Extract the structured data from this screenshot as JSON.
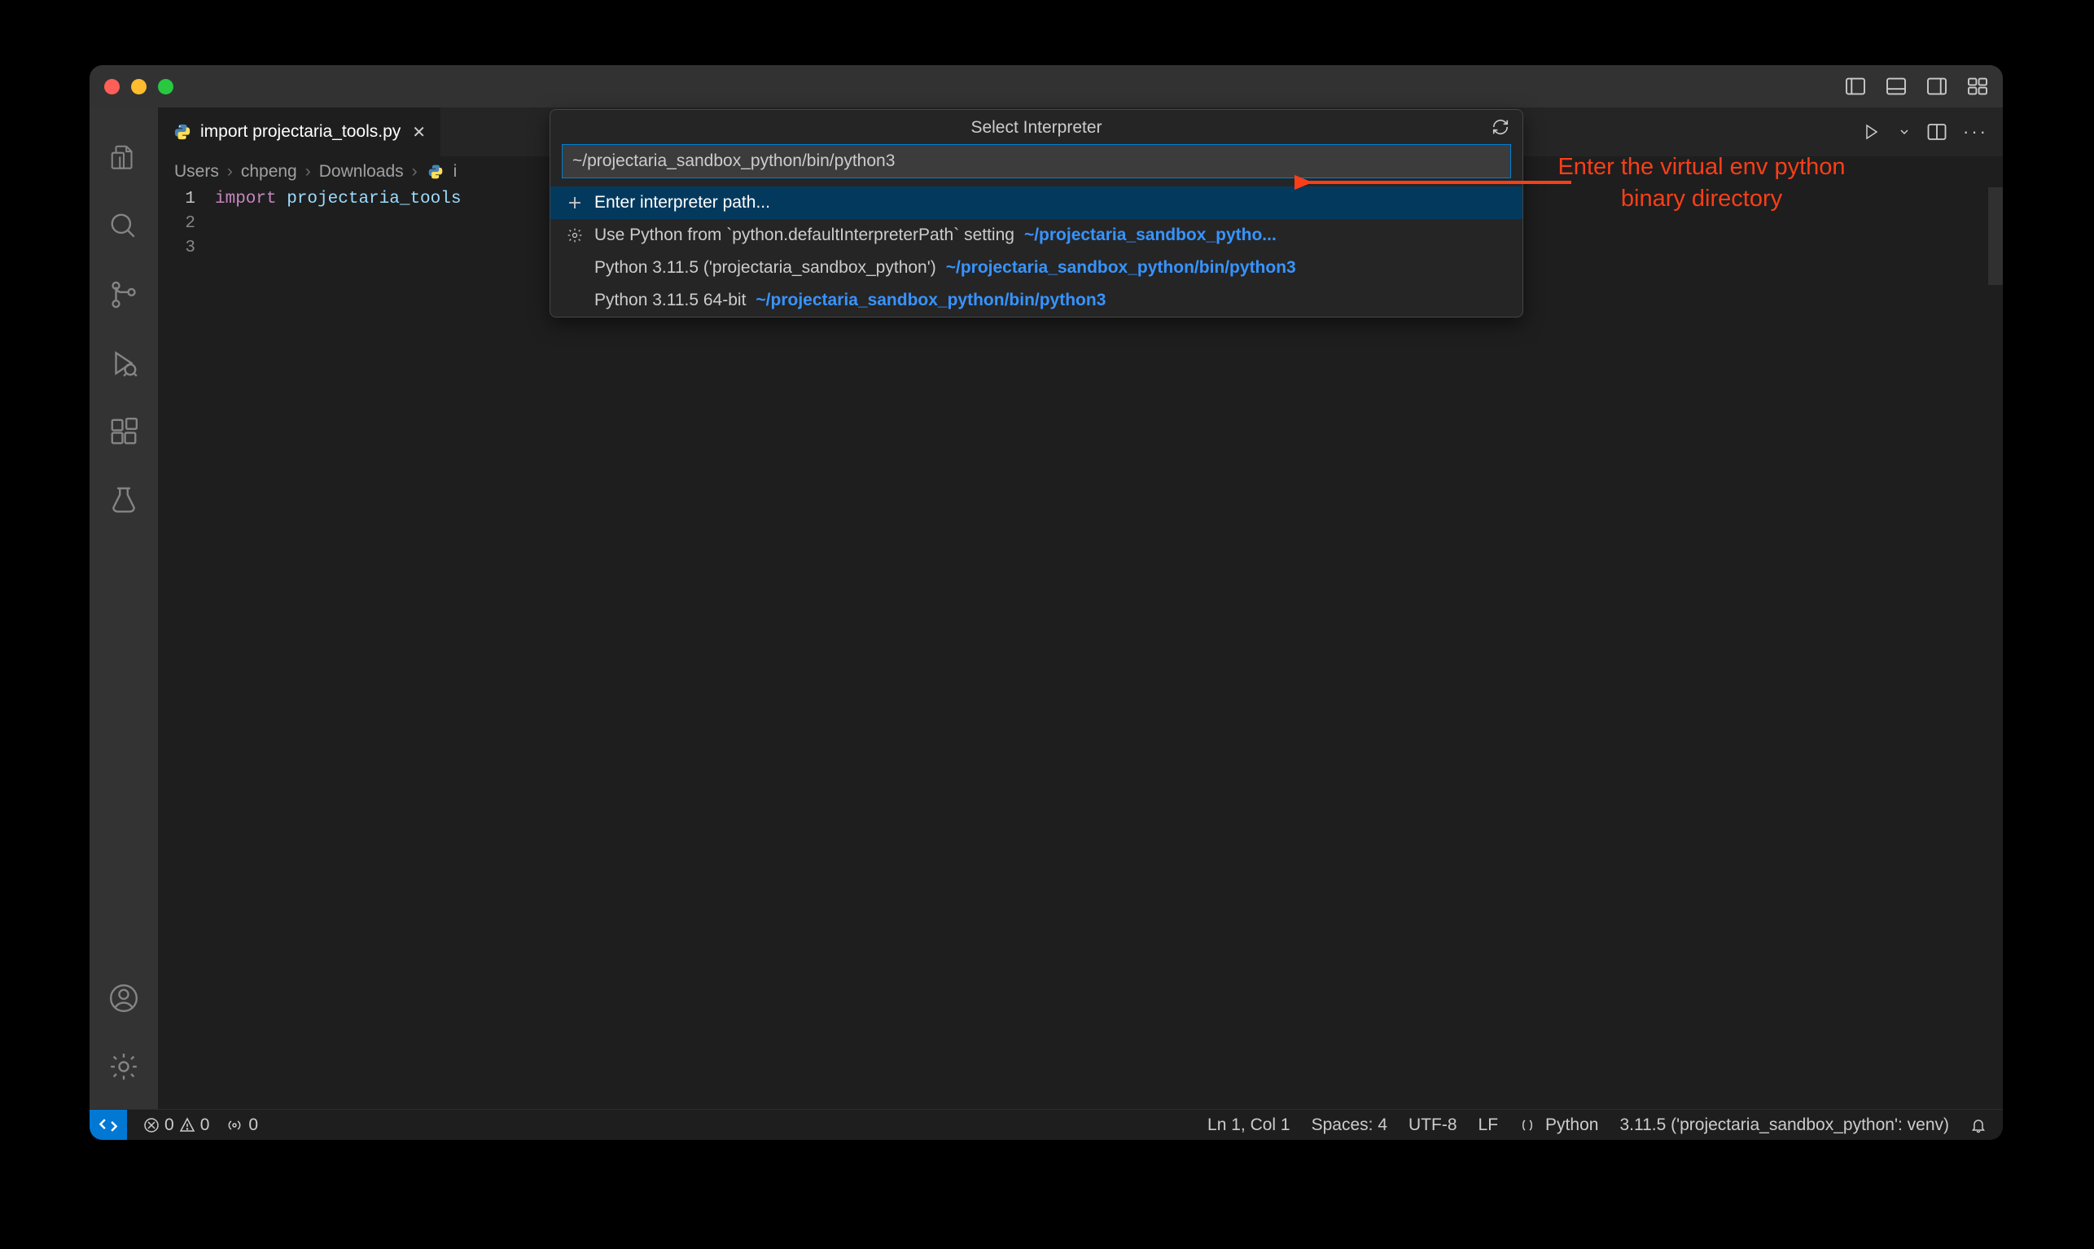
{
  "tab": {
    "filename": "import projectaria_tools.py"
  },
  "breadcrumbs": {
    "seg0": "Users",
    "seg1": "chpeng",
    "seg2": "Downloads",
    "seg3": "i"
  },
  "code": {
    "line1_kw": "import",
    "line1_id": " projectaria_tools"
  },
  "quickpick": {
    "title": "Select Interpreter",
    "input_value": "~/projectaria_sandbox_python/bin/python3",
    "item0_label": "Enter interpreter path...",
    "item1_label": "Use Python from `python.defaultInterpreterPath` setting",
    "item1_path": "~/projectaria_sandbox_pytho...",
    "item2_label": "Python 3.11.5 ('projectaria_sandbox_python')",
    "item2_path": "~/projectaria_sandbox_python/bin/python3",
    "item3_label": "Python 3.11.5 64-bit",
    "item3_path": "~/projectaria_sandbox_python/bin/python3"
  },
  "status": {
    "errors": "0",
    "warnings": "0",
    "ports": "0",
    "cursor": "Ln 1, Col 1",
    "indent": "Spaces: 4",
    "encoding": "UTF-8",
    "eol": "LF",
    "lang": "Python",
    "interpreter": "3.11.5 ('projectaria_sandbox_python': venv)"
  },
  "annotation": {
    "line1": "Enter the virtual env python",
    "line2": "binary directory"
  }
}
